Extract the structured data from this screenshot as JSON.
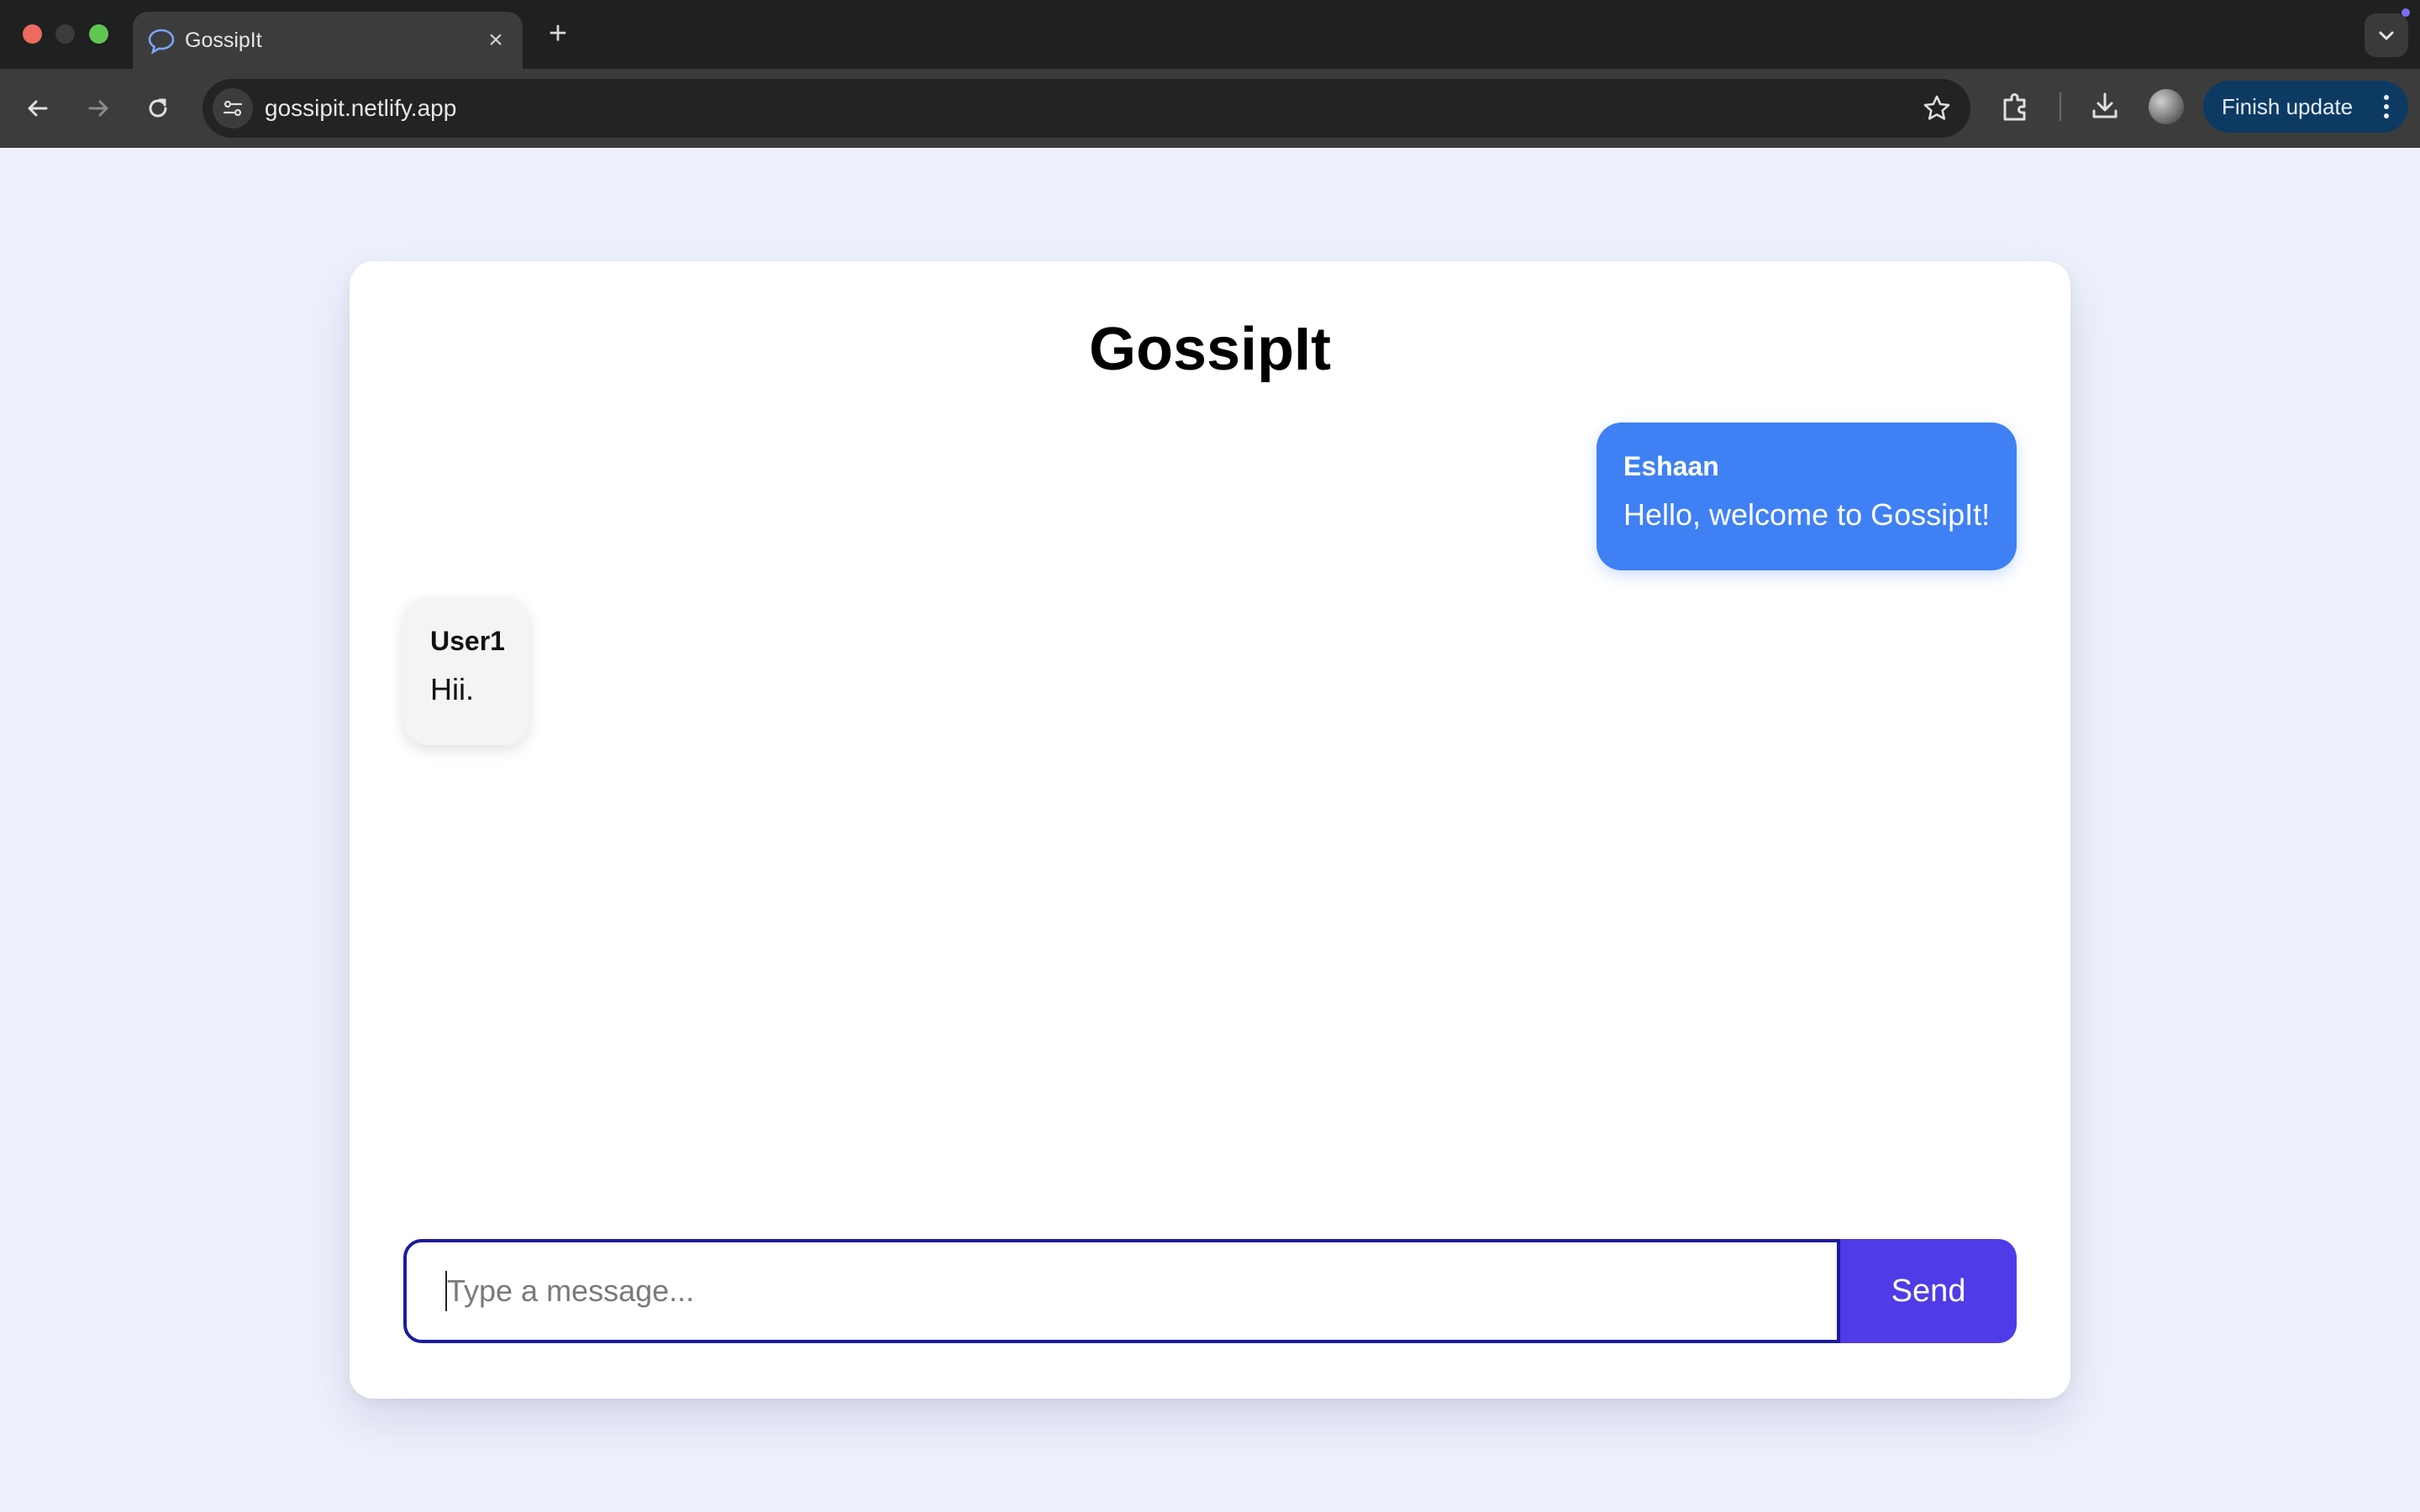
{
  "browser": {
    "tab": {
      "title": "GossipIt",
      "favicon": "chat-bubble-icon"
    },
    "url": "gossipit.netlify.app",
    "update_button": "Finish update"
  },
  "app": {
    "title": "GossipIt",
    "messages": [
      {
        "sender": "Eshaan",
        "text": "Hello, welcome to GossipIt!",
        "own": true,
        "color": "#3f80f5"
      },
      {
        "sender": "User1",
        "text": "Hii.",
        "own": false,
        "color": "#f3f4f6"
      }
    ],
    "composer": {
      "placeholder": "Type a message...",
      "value": "",
      "send_label": "Send",
      "accent": "#4f3ce8"
    }
  }
}
